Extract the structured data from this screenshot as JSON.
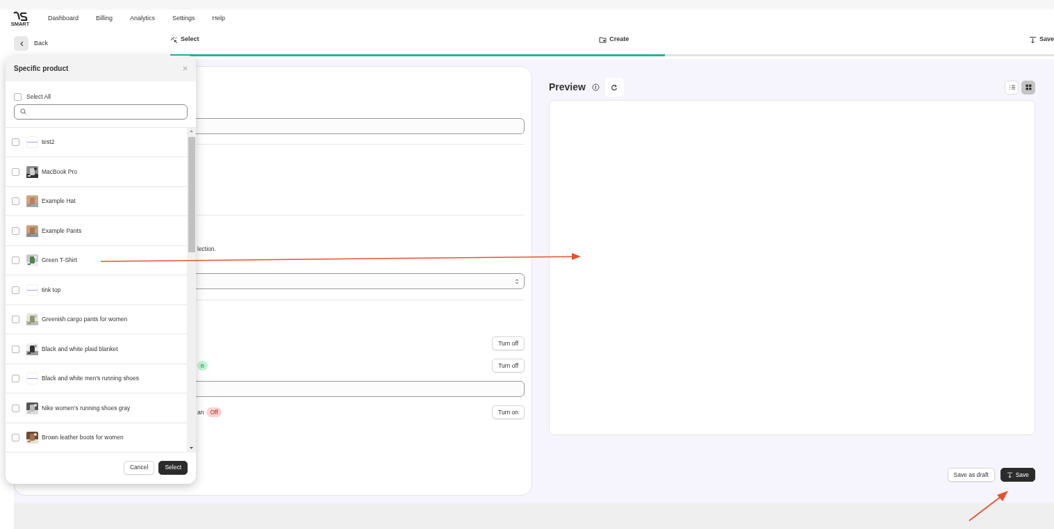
{
  "nav": {
    "logo": "SMART",
    "items": [
      "Dashboard",
      "Billing",
      "Analytics",
      "Settings",
      "Help"
    ]
  },
  "back": "Back",
  "steps": [
    {
      "label": "Select"
    },
    {
      "label": "Create"
    },
    {
      "label": "Save"
    }
  ],
  "progress": {
    "level": 0.56
  },
  "form": {
    "note": "lection.",
    "settings": [
      {
        "button": "Turn off"
      },
      {
        "badge": {
          "text": "n",
          "on": true
        },
        "button": "Turn off"
      },
      {
        "text": "an",
        "badge": {
          "text": "Off",
          "on": false
        },
        "button": "Turn on"
      }
    ]
  },
  "preview": {
    "title": "Preview",
    "views": [
      {
        "kind": "list",
        "selected": false
      },
      {
        "kind": "grid",
        "selected": true
      }
    ],
    "buttons": [
      {
        "label": "Save as draft",
        "primary": false
      },
      {
        "label": "Save",
        "primary": true
      }
    ]
  },
  "modal": {
    "title": "Specific product",
    "select_all": {
      "label": "Select All",
      "checked": false
    },
    "products": [
      {
        "name": "test2",
        "checked": false,
        "kind": "placeholder"
      },
      {
        "name": "MacBook Pro",
        "checked": false,
        "kind": "picture"
      },
      {
        "name": "Example Hat",
        "checked": false,
        "kind": "picture"
      },
      {
        "name": "Example Pants",
        "checked": false,
        "kind": "picture"
      },
      {
        "name": "Green T-Shirt",
        "checked": false,
        "kind": "picture"
      },
      {
        "name": "tink top",
        "checked": false,
        "kind": "placeholder"
      },
      {
        "name": "Greenish cargo pants for women",
        "checked": false,
        "kind": "picture"
      },
      {
        "name": "Black and white plaid blanket",
        "checked": false,
        "kind": "picture"
      },
      {
        "name": "Black and white men's running shoes",
        "checked": false,
        "kind": "placeholder"
      },
      {
        "name": "Nike women's running shoes gray",
        "checked": false,
        "kind": "picture"
      },
      {
        "name": "Brown leather boots for women",
        "checked": false,
        "kind": "picture"
      }
    ],
    "buttons": [
      {
        "label": "Cancel",
        "primary": false
      },
      {
        "label": "Select",
        "primary": true
      }
    ]
  }
}
